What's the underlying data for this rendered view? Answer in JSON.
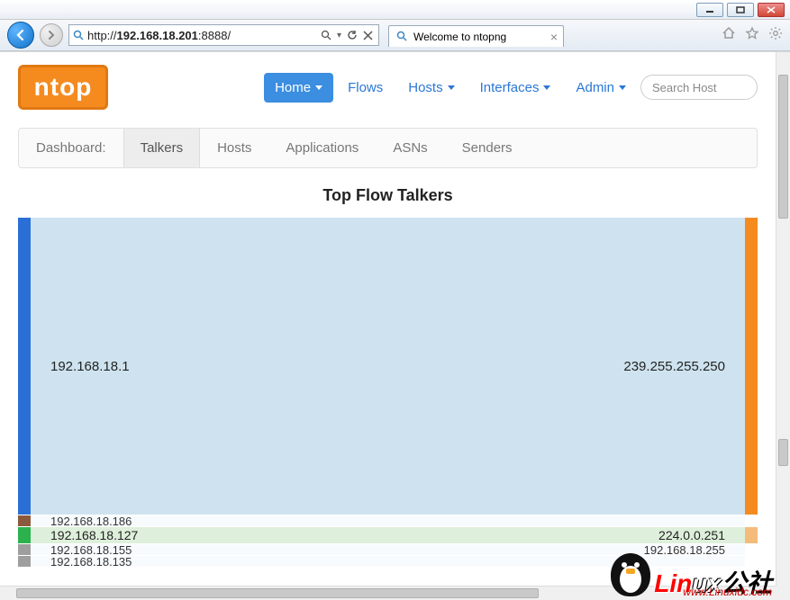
{
  "browser": {
    "url_display": {
      "prefix": "http://",
      "host": "192.168.18.201",
      "port": ":8888/"
    },
    "tab_title": "Welcome to ntopng"
  },
  "brand": {
    "logo_text": "ntop"
  },
  "nav": {
    "home": "Home",
    "flows": "Flows",
    "hosts": "Hosts",
    "interfaces": "Interfaces",
    "admin": "Admin",
    "search_placeholder": "Search Host"
  },
  "subnav": {
    "label": "Dashboard:",
    "talkers": "Talkers",
    "hosts": "Hosts",
    "applications": "Applications",
    "asns": "ASNs",
    "senders": "Senders"
  },
  "chart_data": {
    "type": "sankey",
    "title": "Top Flow Talkers",
    "left_axis": "source_host",
    "right_axis": "destination_host",
    "flows": [
      {
        "source": "192.168.18.1",
        "dest": "239.255.255.250",
        "weight": 330
      },
      {
        "source": "192.168.18.186",
        "dest": "",
        "weight": 12
      },
      {
        "source": "192.168.18.127",
        "dest": "224.0.0.251",
        "weight": 18
      },
      {
        "source": "192.168.18.155",
        "dest": "192.168.18.255",
        "weight": 12
      },
      {
        "source": "192.168.18.135",
        "dest": "",
        "weight": 10
      }
    ],
    "colors": {
      "src_primary": "#2a6fd6",
      "src_green": "#2bb24c",
      "src_grey": "#9e9e9e",
      "src_brown": "#8b5a3c",
      "dst_primary": "#f58b1f",
      "dst_light": "#f5bb7b",
      "band_main": "#cee3ef",
      "band_green": "#def0db"
    }
  },
  "watermark": {
    "big_red": "Lin",
    "big_white": "ux",
    "big_black": "公社",
    "sub": "www.Linuxidc.com"
  }
}
